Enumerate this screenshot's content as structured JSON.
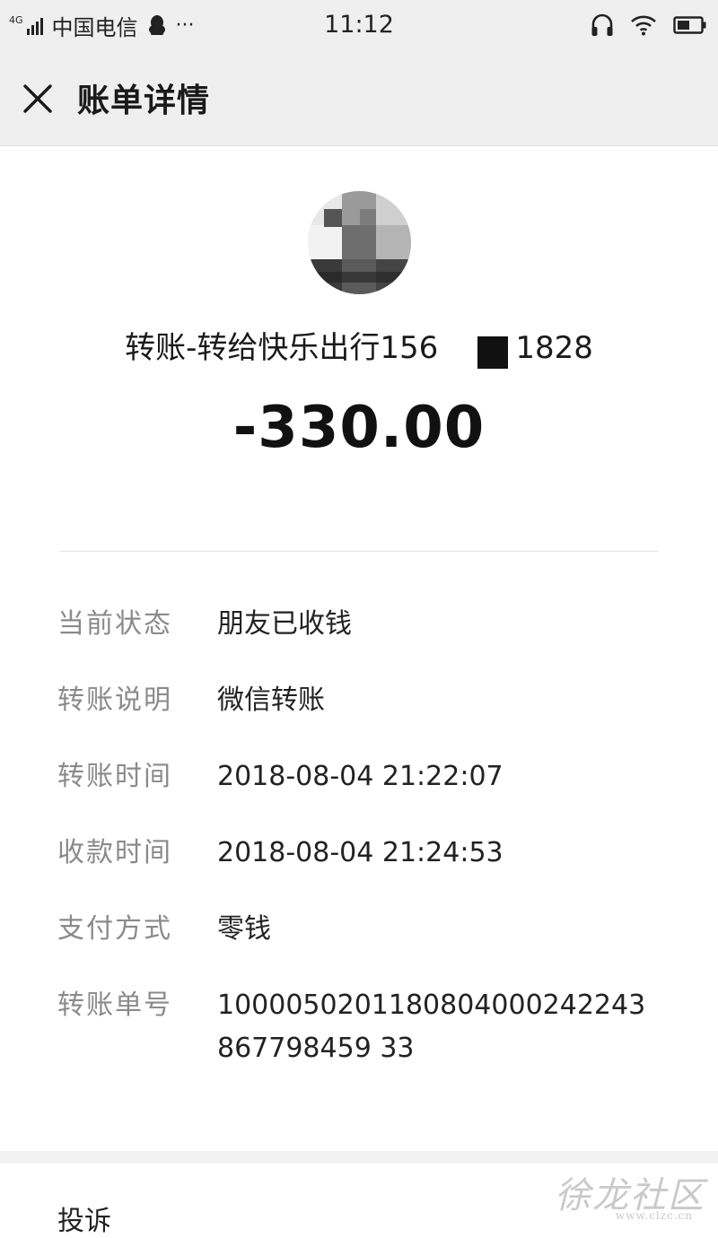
{
  "status_bar": {
    "network": "4G",
    "carrier": "中国电信",
    "more": "···",
    "time": "11:12"
  },
  "nav": {
    "title": "账单详情"
  },
  "transaction": {
    "payee_prefix": "转账-转给快乐出行156",
    "payee_suffix": "1828",
    "amount": "-330.00"
  },
  "details": [
    {
      "label": "当前状态",
      "value": "朋友已收钱"
    },
    {
      "label": "转账说明",
      "value": "微信转账"
    },
    {
      "label": "转账时间",
      "value": "2018-08-04 21:22:07"
    },
    {
      "label": "收款时间",
      "value": "2018-08-04 21:24:53"
    },
    {
      "label": "支付方式",
      "value": "零钱"
    },
    {
      "label": "转账单号",
      "value": "1000050201180804000242243867798459 33"
    }
  ],
  "footer": {
    "complain_label": "投诉"
  },
  "watermark": {
    "text": "徐龙社区",
    "site": "www.clzc.cn"
  }
}
